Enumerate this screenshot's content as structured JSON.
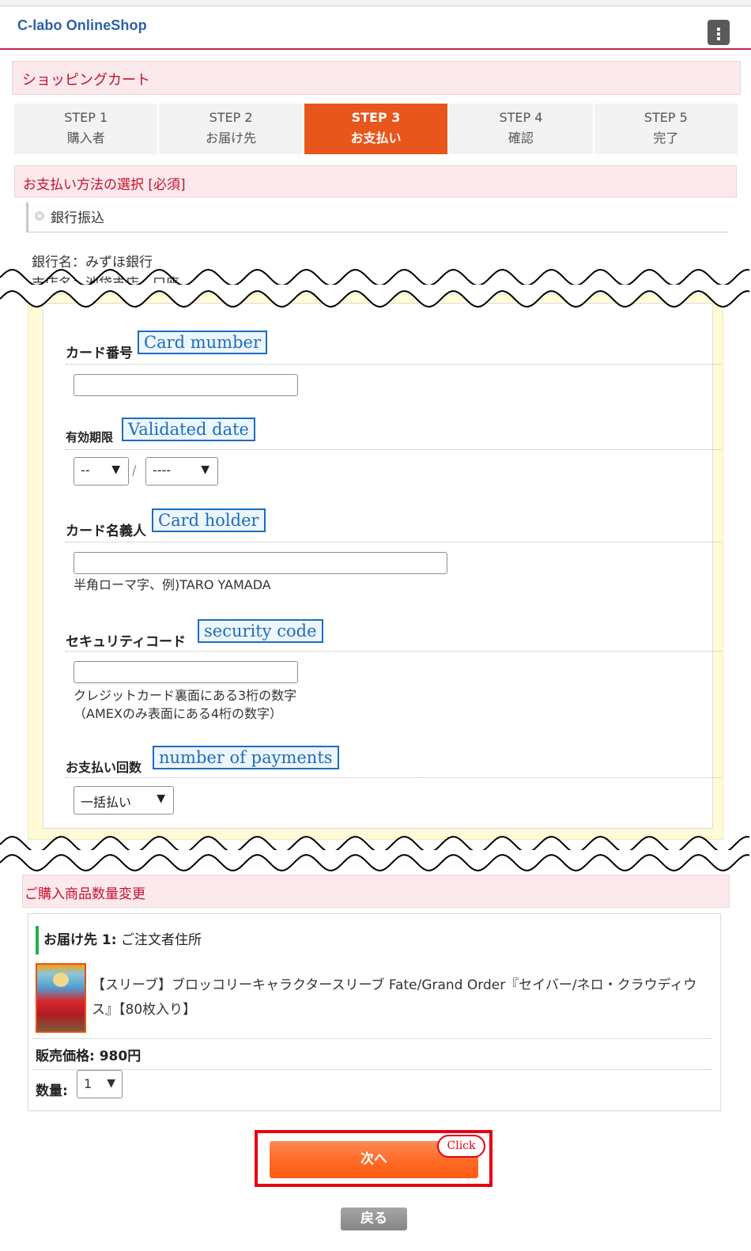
{
  "header": {
    "logo": "C-labo OnlineShop",
    "menu_icon": "vertical-ellipsis-icon"
  },
  "cart_title": "ショッピングカート",
  "steps": [
    {
      "step": "STEP 1",
      "label": "購入者",
      "active": false
    },
    {
      "step": "STEP 2",
      "label": "お届け先",
      "active": false
    },
    {
      "step": "STEP 3",
      "label": "お支払い",
      "active": true
    },
    {
      "step": "STEP 4",
      "label": "確認",
      "active": false
    },
    {
      "step": "STEP 5",
      "label": "完了",
      "active": false
    }
  ],
  "payment": {
    "section_title": "お支払い方法の選択 [必須]",
    "bank_option": "銀行振込",
    "bank_name": "銀行名：みずほ銀行",
    "bank_line2": "支店名：池袋支店　口座"
  },
  "card_form": {
    "card_number": {
      "label": "カード番号",
      "annotation": "Card mumber",
      "value": ""
    },
    "expiry": {
      "label": "有効期限",
      "annotation": "Validated date",
      "month": "--",
      "separator": "/",
      "year": "----"
    },
    "holder": {
      "label": "カード名義人",
      "annotation": "Card holder",
      "value": "",
      "hint": "半角ローマ字、例)TARO YAMADA"
    },
    "security": {
      "label": "セキュリティコード",
      "annotation": "security code",
      "value": "",
      "hint1": "クレジットカード裏面にある3桁の数字",
      "hint2": "（AMEXのみ表面にある4桁の数字）"
    },
    "installments": {
      "label": "お支払い回数",
      "annotation": "number of payments",
      "value": "一括払い"
    }
  },
  "quantity_section": {
    "title": "ご購入商品数量変更",
    "ship_to_prefix": "お届け先 1:",
    "ship_to": "ご注文者住所",
    "product_name": "【スリーブ】ブロッコリーキャラクタースリーブ Fate/Grand Order『セイバー/ネロ・クラウディウス』【80枚入り】",
    "price_label": "販売価格",
    "price": "980円",
    "qty_label": "数量",
    "qty_value": "1"
  },
  "actions": {
    "next": "次へ",
    "click_badge": "Click",
    "back": "戻る"
  },
  "colors": {
    "brand_red": "#c8102e",
    "step_active": "#e8561c",
    "next_button": "#ff6d2a",
    "annotation_blue": "#1b6dbf",
    "highlight_red": "#e60012"
  }
}
